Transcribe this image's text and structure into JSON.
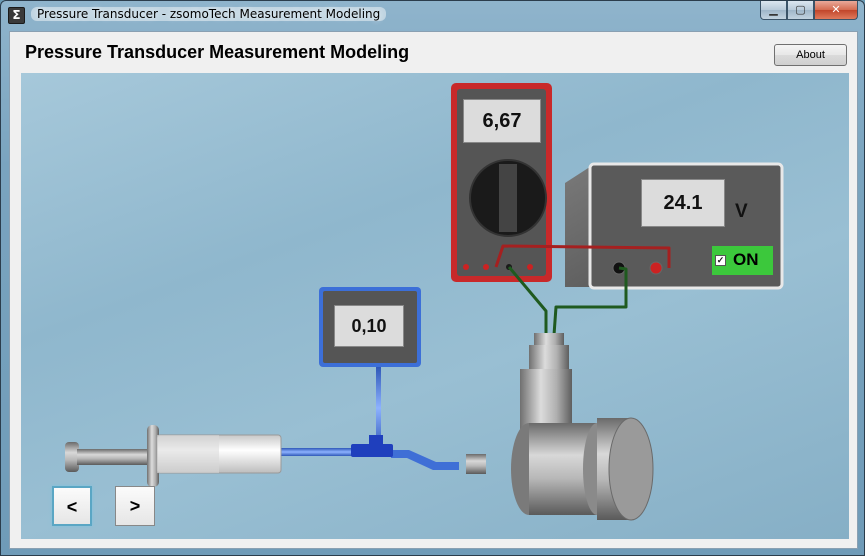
{
  "window": {
    "title": "Pressure Transducer - zsomoTech Measurement Modeling",
    "app_icon_glyph": "Σ",
    "minimize_glyph": "▁",
    "maximize_glyph": "▢",
    "close_glyph": "✕"
  },
  "header": {
    "title": "Pressure Transducer Measurement Modeling",
    "about_label": "About"
  },
  "multimeter": {
    "reading": "6,67"
  },
  "power_supply": {
    "voltage": "24.1",
    "unit": "V",
    "switch_label": "ON",
    "switch_checked": true,
    "check_glyph": "✓"
  },
  "pressure_gauge": {
    "reading": "0,10"
  },
  "navigation": {
    "prev_label": "<",
    "next_label": ">"
  },
  "colors": {
    "multimeter_frame": "#c8292a",
    "gauge_frame": "#3c6fd8",
    "tube": "#3f6fd6",
    "wire_red": "#a52020",
    "wire_green": "#1f5a1f",
    "switch_on": "#3cc83c"
  }
}
